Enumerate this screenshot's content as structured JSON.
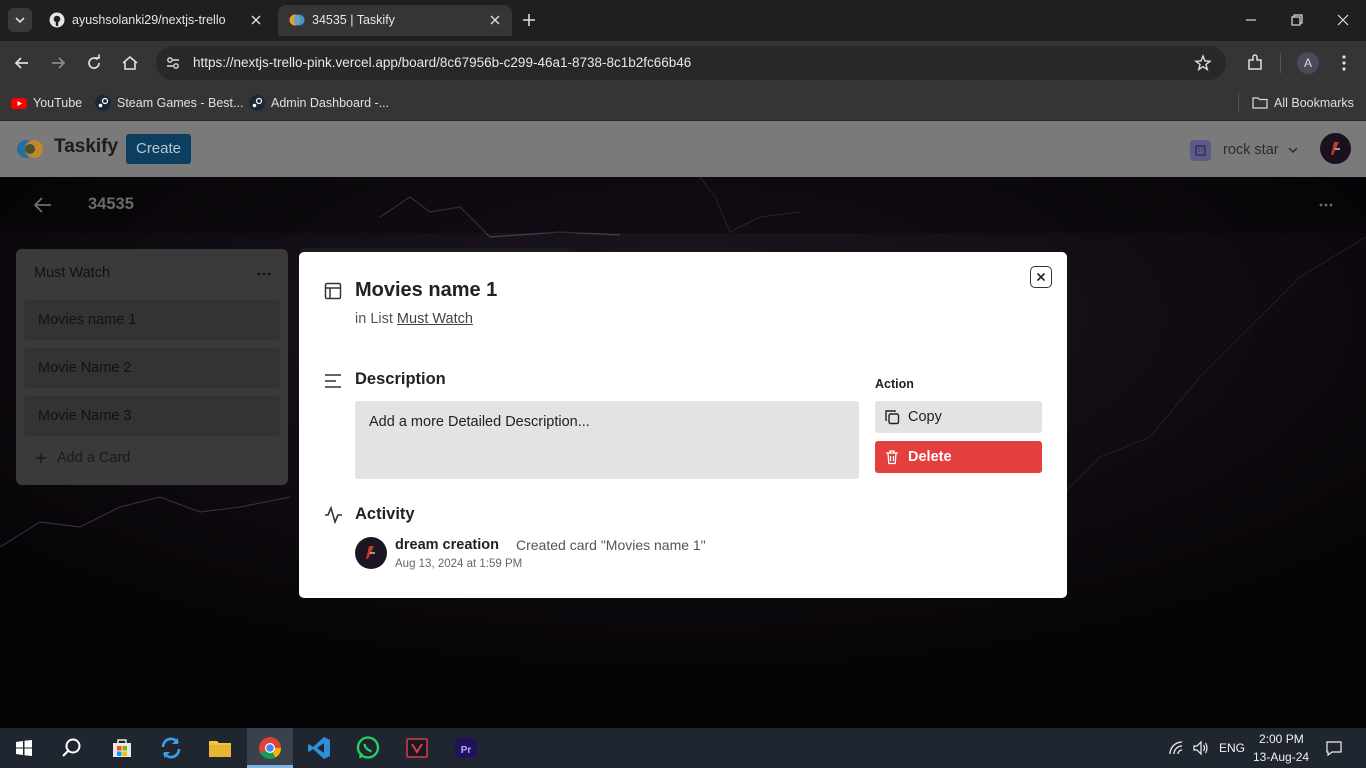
{
  "browser": {
    "tabs": [
      {
        "title": "ayushsolanki29/nextjs-trello",
        "active": false
      },
      {
        "title": "34535 | Taskify",
        "active": true
      }
    ],
    "url": "https://nextjs-trello-pink.vercel.app/board/8c67956b-c299-46a1-8738-8c1b2fc66b46",
    "profile_initial": "A",
    "bookmarks": [
      "YouTube",
      "Steam Games - Best...",
      "Admin Dashboard -..."
    ],
    "all_bookmarks": "All Bookmarks"
  },
  "app": {
    "logo_text": "Taskify",
    "create_label": "Create",
    "org_name": "rock star"
  },
  "board": {
    "title": "34535",
    "list": {
      "title": "Must Watch",
      "cards": [
        "Movies name 1",
        "Movie Name 2",
        "Movie Name 3"
      ],
      "add_card": "Add a Card"
    }
  },
  "modal": {
    "title": "Movies name 1",
    "in_list_prefix": "in List",
    "list_name": "Must Watch",
    "description_label": "Description",
    "description_placeholder": "Add a more Detailed Description...",
    "action_label": "Action",
    "copy_label": "Copy",
    "delete_label": "Delete",
    "activity_label": "Activity",
    "activity": {
      "user": "dream creation",
      "text": "Created card \"Movies name 1\"",
      "time": "Aug 13, 2024 at 1:59 PM"
    }
  },
  "taskbar": {
    "lang": "ENG",
    "time": "2:00 PM",
    "date": "13-Aug-24"
  },
  "colors": {
    "delete": "#e53e3e",
    "create_btn": "#0c3e5f"
  }
}
